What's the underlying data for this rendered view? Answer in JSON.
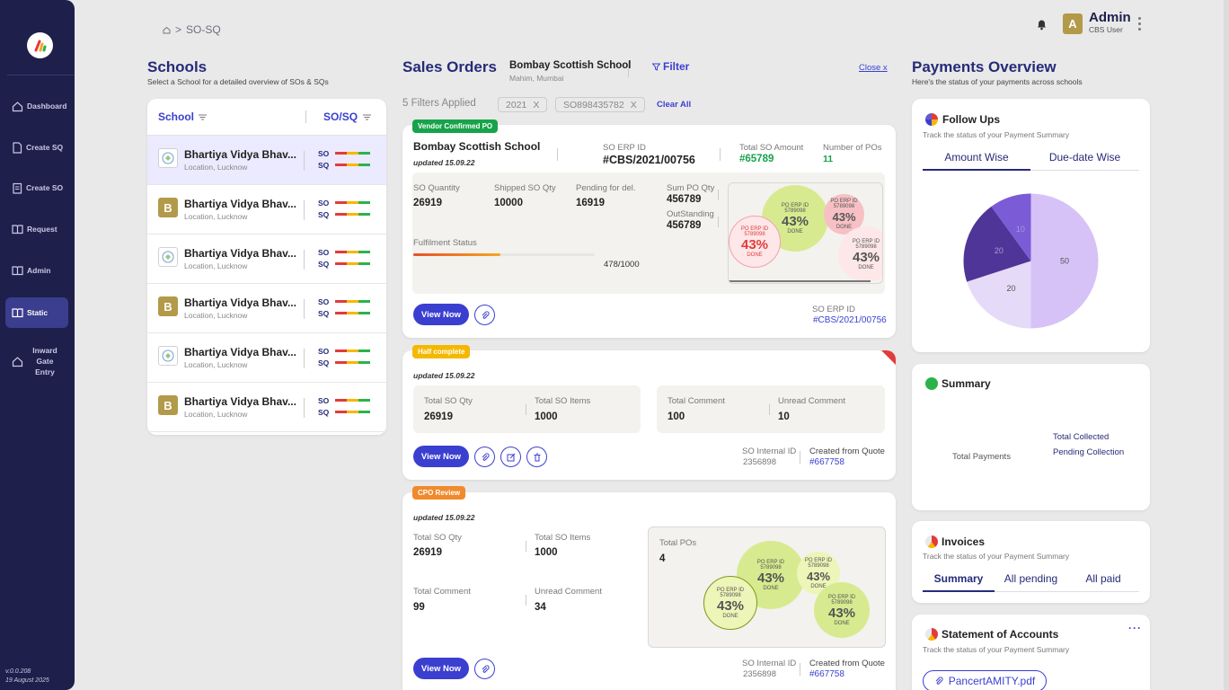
{
  "sidebar": {
    "items": [
      {
        "label": "Dashboard"
      },
      {
        "label": "Create SQ"
      },
      {
        "label": "Create SO"
      },
      {
        "label": "Request"
      },
      {
        "label": "Admin"
      },
      {
        "label": "Static"
      },
      {
        "label": "Inward Gate Entry"
      }
    ],
    "version": "v.0.0.208",
    "date": "19 August 2025"
  },
  "header": {
    "breadcrumb": "SO-SQ",
    "user_initial": "A",
    "user_name": "Admin",
    "user_role": "CBS User"
  },
  "schools": {
    "title": "Schools",
    "subtitle": "Select a School for a detailed overview of SOs & SQs",
    "col_school": "School",
    "col_sosq": "SO/SQ",
    "so_label": "SO",
    "sq_label": "SQ",
    "rows": [
      {
        "initial": "",
        "name": "Bhartiya Vidya Bhav...",
        "location": "Location, Lucknow"
      },
      {
        "initial": "B",
        "name": "Bhartiya Vidya Bhav...",
        "location": "Location, Lucknow"
      },
      {
        "initial": "",
        "name": "Bhartiya Vidya Bhav...",
        "location": "Location, Lucknow"
      },
      {
        "initial": "B",
        "name": "Bhartiya Vidya Bhav...",
        "location": "Location, Lucknow"
      },
      {
        "initial": "",
        "name": "Bhartiya Vidya Bhav...",
        "location": "Location, Lucknow"
      },
      {
        "initial": "B",
        "name": "Bhartiya Vidya Bhav...",
        "location": "Location, Lucknow"
      }
    ]
  },
  "sales": {
    "title": "Sales Orders",
    "school": "Bombay Scottish School",
    "school_loc": "Mahim, Mumbai",
    "filter": "Filter",
    "close": "Close x",
    "filters_applied": "5 Filters Applied",
    "chips": [
      "2021",
      "SO898435782"
    ],
    "chip_x": "X",
    "clear_all": "Clear All",
    "view_now": "View Now",
    "card1": {
      "tag": "Vendor Confirmed PO",
      "school": "Bombay Scottish School",
      "updated": "updated 15.09.22",
      "erp_label": "SO ERP ID",
      "erp": "#CBS/2021/00756",
      "amt_label": "Total SO Amount",
      "amt": "#65789",
      "pos_label": "Number of POs",
      "pos": "11",
      "qty_label": "SO Quantity",
      "qty": "26919",
      "ship_label": "Shipped SO Qty",
      "ship": "10000",
      "pend_label": "Pending for del.",
      "pend": "16919",
      "ful_label": "Fulfilment Status",
      "ful": "478/1000",
      "ful_pct": 0.478,
      "sum_label": "Sum PO Qty",
      "sum": "456789",
      "out_label": "OutStanding",
      "out": "456789",
      "bubbles": [
        {
          "id": "PO ERP ID",
          "num": "5789098",
          "pct": "43%",
          "done": "DONE"
        },
        {
          "id": "PO ERP ID",
          "num": "5789098",
          "pct": "43%",
          "done": "DONE"
        },
        {
          "id": "PO ERP ID",
          "num": "5789098",
          "pct": "43%",
          "done": "DONE"
        },
        {
          "id": "PO ERP ID",
          "num": "5789098",
          "pct": "43%",
          "done": "DONE"
        }
      ],
      "footer_label": "SO ERP ID",
      "footer_val": "#CBS/2021/00756"
    },
    "card2": {
      "tag": "Half complete",
      "updated": "updated 15.09.22",
      "tq_label": "Total SO Qty",
      "tq": "26919",
      "ti_label": "Total SO Items",
      "ti": "1000",
      "tc_label": "Total Comment",
      "tc": "100",
      "uc_label": "Unread Comment",
      "uc": "10",
      "int_label": "SO Internal ID",
      "int": "2356898",
      "quote_label": "Created from Quote",
      "quote": "#667758"
    },
    "card3": {
      "tag": "CPO Review",
      "updated": "updated 15.09.22",
      "tq_label": "Total SO Qty",
      "tq": "26919",
      "ti_label": "Total SO Items",
      "ti": "1000",
      "tc_label": "Total Comment",
      "tc": "99",
      "uc_label": "Unread Comment",
      "uc": "34",
      "pos_label": "Total POs",
      "pos": "4",
      "bubbles": [
        {
          "id": "PO ERP ID",
          "num": "5789098",
          "pct": "43%",
          "done": "DONE"
        },
        {
          "id": "PO ERP ID",
          "num": "5789098",
          "pct": "43%",
          "done": "DONE"
        },
        {
          "id": "PO ERP ID",
          "num": "5789098",
          "pct": "43%",
          "done": "DONE"
        },
        {
          "id": "PO ERP ID",
          "num": "5789098",
          "pct": "43%",
          "done": "DONE"
        }
      ],
      "int_label": "SO Internal ID",
      "int": "2356898",
      "quote_label": "Created from Quote",
      "quote": "#667758"
    }
  },
  "payments": {
    "title": "Payments Overview",
    "subtitle": "Here's the status of your payments across schools",
    "followups": {
      "title": "Follow Ups",
      "sub": "Track the status of your Payment Summary",
      "tabs": [
        "Amount Wise",
        "Due-date Wise"
      ]
    },
    "summary": {
      "title": "Summary",
      "total_payments": "Total Payments",
      "total_collected": "Total Collected",
      "pending": "Pending Collection"
    },
    "invoices": {
      "title": "Invoices",
      "sub": "Track the status of your Payment Summary",
      "tabs": [
        "Summary",
        "All pending",
        "All paid"
      ]
    },
    "statement": {
      "title": "Statement of Accounts",
      "sub": "Track the status of your Payment Summary",
      "file": "PancertAMITY.pdf"
    }
  },
  "chart_data": {
    "type": "pie",
    "values": [
      50,
      20,
      20,
      10
    ],
    "labels": [
      "50",
      "20",
      "20",
      "10"
    ],
    "colors": [
      "#d6c2f7",
      "#e6daf9",
      "#4f3597",
      "#7b5bd6"
    ]
  }
}
